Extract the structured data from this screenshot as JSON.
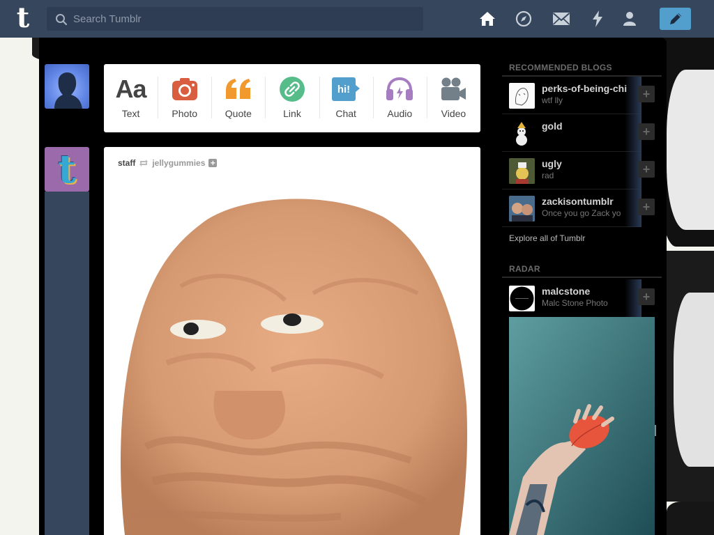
{
  "header": {
    "logo": "t",
    "search_placeholder": "Search Tumblr",
    "icons": [
      "home-icon",
      "explore-icon",
      "inbox-icon",
      "activity-icon",
      "account-icon",
      "compose-icon"
    ],
    "color": "#36465d",
    "compose_color": "#529ecc"
  },
  "post_types": [
    {
      "label": "Text",
      "icon": "text-icon",
      "color": "#444444"
    },
    {
      "label": "Photo",
      "icon": "camera-icon",
      "color": "#d95e40"
    },
    {
      "label": "Quote",
      "icon": "quote-icon",
      "color": "#f2992e"
    },
    {
      "label": "Link",
      "icon": "link-icon",
      "color": "#56bc8a"
    },
    {
      "label": "Chat",
      "icon": "chat-icon",
      "color": "#529ecc"
    },
    {
      "label": "Audio",
      "icon": "headphones-icon",
      "color": "#a77dc2"
    },
    {
      "label": "Video",
      "icon": "video-camera-icon",
      "color": "#748089"
    }
  ],
  "post": {
    "author": "staff",
    "source": "jellygummies",
    "follow_symbol": "+"
  },
  "sidebar": {
    "recommended_title": "RECOMMENDED BLOGS",
    "blogs": [
      {
        "name": "perks-of-being-chi",
        "desc": "wtf lly"
      },
      {
        "name": "gold",
        "desc": ""
      },
      {
        "name": "ugly",
        "desc": "rad"
      },
      {
        "name": "zackisontumblr",
        "desc": "Once you go Zack yo"
      }
    ],
    "explore_link": "Explore all of Tumblr",
    "radar_title": "RADAR",
    "radar_blog": {
      "name": "malcstone",
      "desc": "Malc Stone Photo"
    },
    "follow_symbol": "+"
  }
}
